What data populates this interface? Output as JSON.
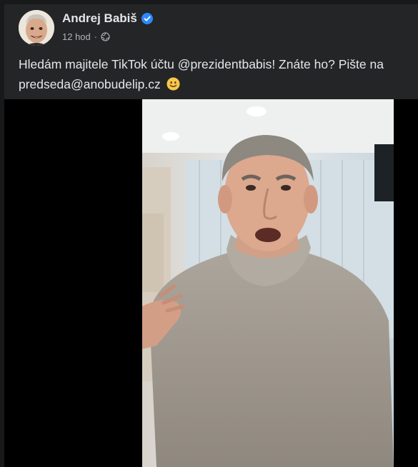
{
  "post": {
    "author": "Andrej Babiš",
    "time": "12 hod",
    "separator": "·",
    "text": "Hledám majitele TikTok účtu @prezidentbabis! Znáte ho? Pište na predseda@anobudelip.cz"
  },
  "icons": {
    "verified": "verified-badge-icon",
    "privacy": "globe-icon",
    "emoji": "smiling-face-emoji"
  },
  "colors": {
    "background": "#18191a",
    "card": "#242526",
    "text_primary": "#e4e6eb",
    "text_secondary": "#b0b3b8",
    "verified_blue": "#2d88ff"
  }
}
